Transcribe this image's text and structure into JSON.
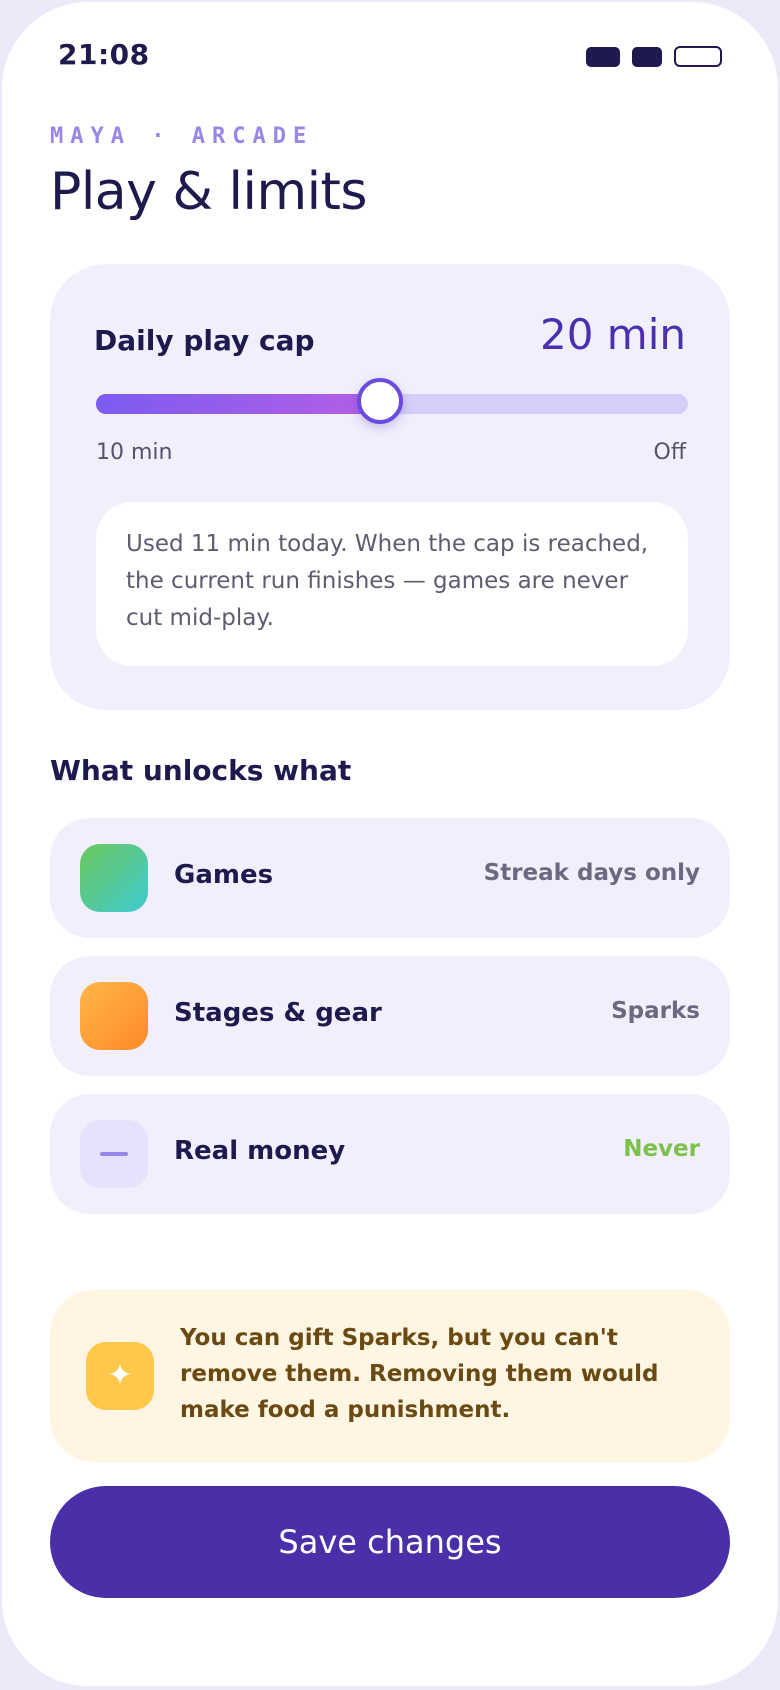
{
  "status_bar": {
    "time": "21:08"
  },
  "header": {
    "eyebrow": "MAYA · ARCADE",
    "title": "Play & limits"
  },
  "daily_cap": {
    "label": "Daily play cap",
    "value_label": "20 min",
    "slider": {
      "level_fraction": 0.48,
      "min_label": "10 min",
      "max_label": "Off"
    },
    "note": "Used 11 min today. When the cap is reached, the current run finishes — games are never cut mid-play."
  },
  "unlocks": {
    "section_title": "What unlocks what",
    "items": [
      {
        "label": "Games",
        "value": "Streak days only",
        "icon": "games-icon"
      },
      {
        "label": "Stages & gear",
        "value": "Sparks",
        "icon": "stages-gear-icon"
      },
      {
        "label": "Real money",
        "value": "Never",
        "icon": "minus-icon"
      }
    ]
  },
  "tip": {
    "icon": "sparkle-icon",
    "glyph": "✦",
    "text": "You can gift Sparks, but you can't remove them. Removing them would make food a punishment."
  },
  "footer": {
    "save_label": "Save changes"
  },
  "colors": {
    "accent": "#4B2FA8",
    "card_bg": "#F1EFFC",
    "never_green": "#7BC24A",
    "tip_bg": "#FEF6E2"
  }
}
